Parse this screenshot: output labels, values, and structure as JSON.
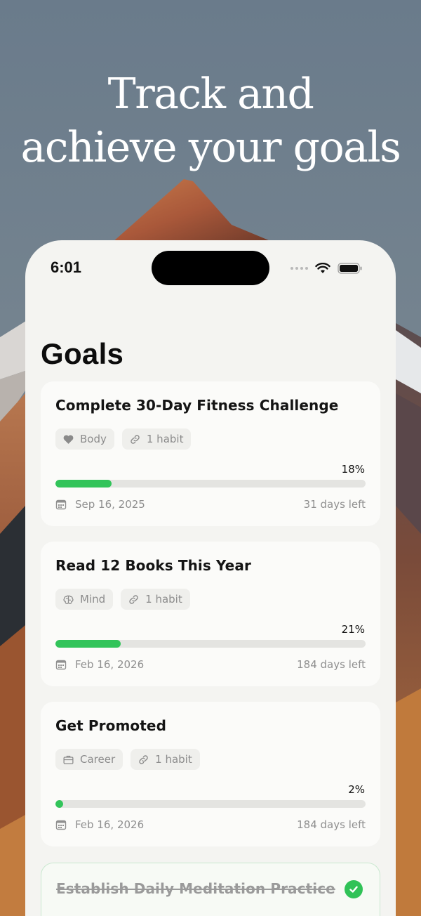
{
  "hero": {
    "line1": "Track and",
    "line2": "achieve your goals"
  },
  "status_bar": {
    "time": "6:01"
  },
  "page": {
    "title": "Goals"
  },
  "colors": {
    "accent_green": "#32c45a",
    "card_bg": "#fbfbf9",
    "screen_bg": "#f4f4f1"
  },
  "goals": [
    {
      "title": "Complete 30-Day Fitness Challenge",
      "category": "Body",
      "category_icon": "heart-icon",
      "habits": "1 habit",
      "progress_label": "18%",
      "progress": 0.18,
      "date": "Sep 16, 2025",
      "remaining": "31 days left"
    },
    {
      "title": "Read 12 Books This Year",
      "category": "Mind",
      "category_icon": "brain-icon",
      "habits": "1 habit",
      "progress_label": "21%",
      "progress": 0.21,
      "date": "Feb 16, 2026",
      "remaining": "184 days left"
    },
    {
      "title": "Get Promoted",
      "category": "Career",
      "category_icon": "briefcase-icon",
      "habits": "1 habit",
      "progress_label": "2%",
      "progress": 0.02,
      "date": "Feb 16, 2026",
      "remaining": "184 days left"
    },
    {
      "title": "Establish Daily Meditation Practice",
      "completed": true
    }
  ]
}
